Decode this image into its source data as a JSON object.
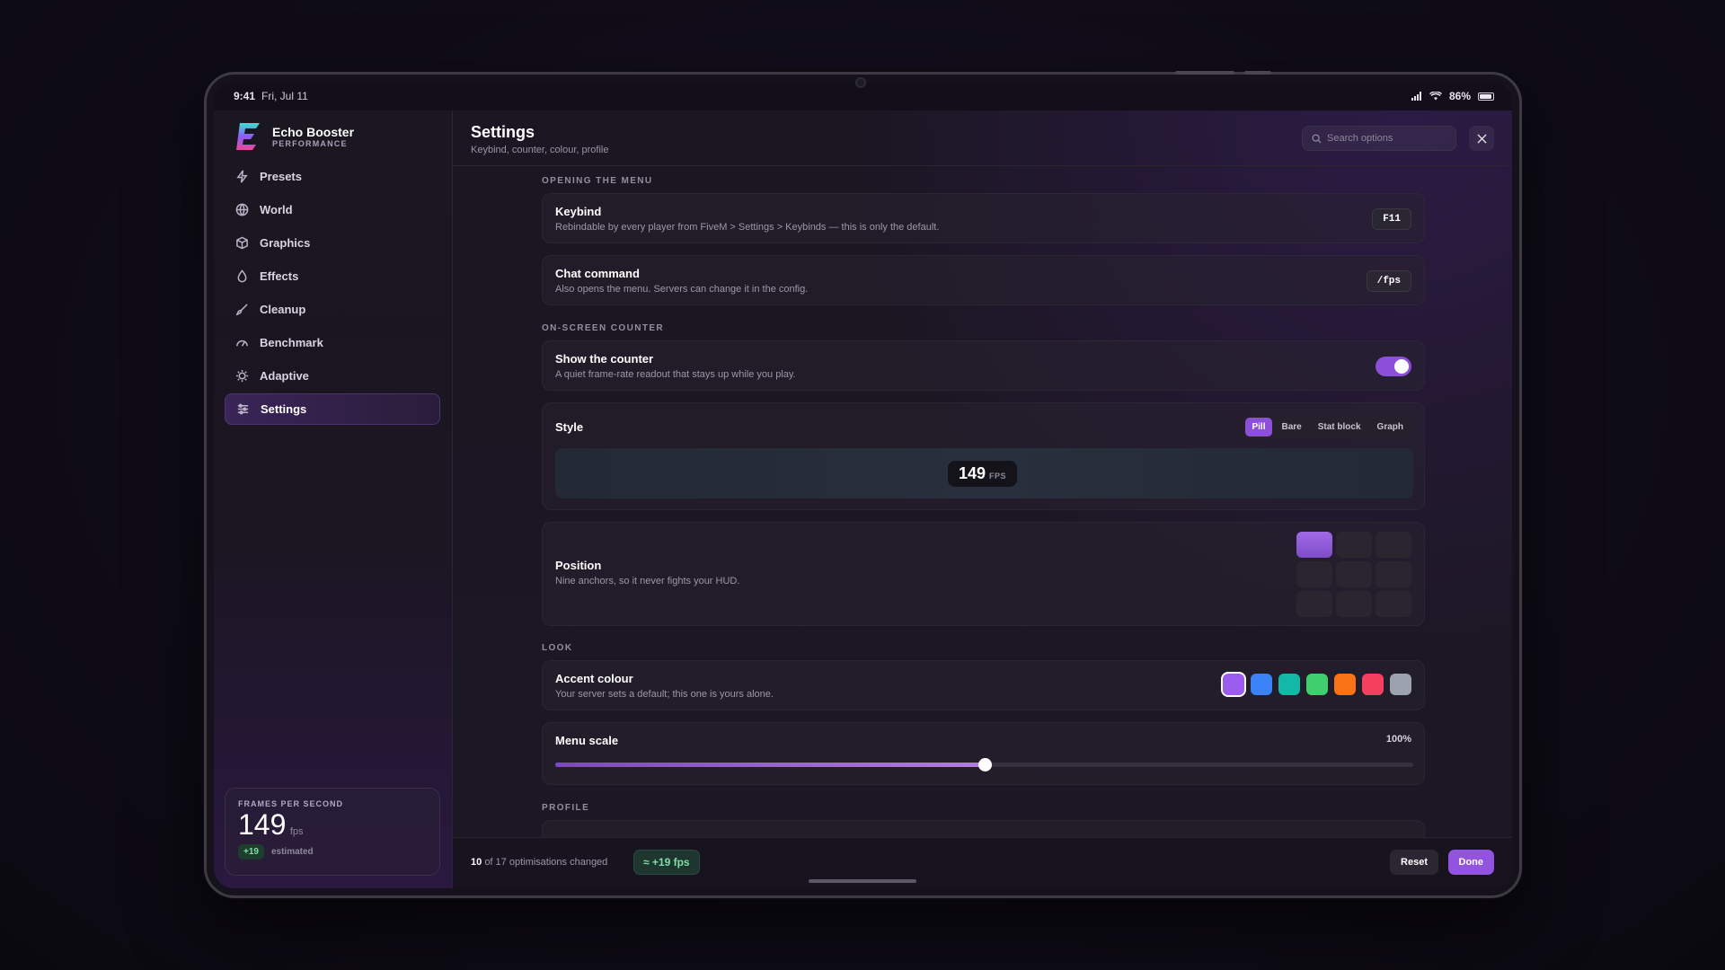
{
  "status": {
    "time": "9:41",
    "date": "Fri, Jul 11",
    "battery": "86%"
  },
  "brand": {
    "name": "Echo Booster",
    "subtitle": "PERFORMANCE"
  },
  "nav": [
    {
      "label": "Presets",
      "icon": "bolt-icon"
    },
    {
      "label": "World",
      "icon": "globe-icon"
    },
    {
      "label": "Graphics",
      "icon": "cube-icon"
    },
    {
      "label": "Effects",
      "icon": "droplet-icon"
    },
    {
      "label": "Cleanup",
      "icon": "brush-icon"
    },
    {
      "label": "Benchmark",
      "icon": "gauge-icon"
    },
    {
      "label": "Adaptive",
      "icon": "sun-icon"
    },
    {
      "label": "Settings",
      "icon": "sliders-icon",
      "active": true
    }
  ],
  "fps_card": {
    "label": "FRAMES PER SECOND",
    "value": "149",
    "unit": "fps",
    "delta": "+19",
    "note": "estimated"
  },
  "header": {
    "title": "Settings",
    "subtitle": "Keybind, counter, colour, profile",
    "search_placeholder": "Search options"
  },
  "sections": {
    "opening": "OPENING THE MENU",
    "counter": "ON-SCREEN COUNTER",
    "look": "LOOK",
    "profile": "PROFILE"
  },
  "keybind": {
    "title": "Keybind",
    "desc": "Rebindable by every player from FiveM > Settings > Keybinds — this is only the default.",
    "value": "F11"
  },
  "chat": {
    "title": "Chat command",
    "desc": "Also opens the menu. Servers can change it in the config.",
    "value": "/fps"
  },
  "show_counter": {
    "title": "Show the counter",
    "desc": "A quiet frame-rate readout that stays up while you play.",
    "on": true
  },
  "style": {
    "title": "Style",
    "options": [
      "Pill",
      "Bare",
      "Stat block",
      "Graph"
    ],
    "selected": "Pill",
    "preview_value": "149",
    "preview_unit": "FPS"
  },
  "position": {
    "title": "Position",
    "desc": "Nine anchors, so it never fights your HUD.",
    "selected_index": 0
  },
  "accent": {
    "title": "Accent colour",
    "desc": "Your server sets a default; this one is yours alone.",
    "colors": [
      "#9d5cf0",
      "#3b82f6",
      "#14b8a6",
      "#3fcf6e",
      "#f97316",
      "#f43f5e",
      "#9ca3af"
    ],
    "selected_index": 0
  },
  "menu_scale": {
    "title": "Menu scale",
    "value": "100%",
    "fraction": 0.5
  },
  "footer": {
    "changed": "10",
    "total_text": "of 17 optimisations changed",
    "fps_gain": "≈ +19 fps",
    "reset": "Reset",
    "done": "Done"
  }
}
